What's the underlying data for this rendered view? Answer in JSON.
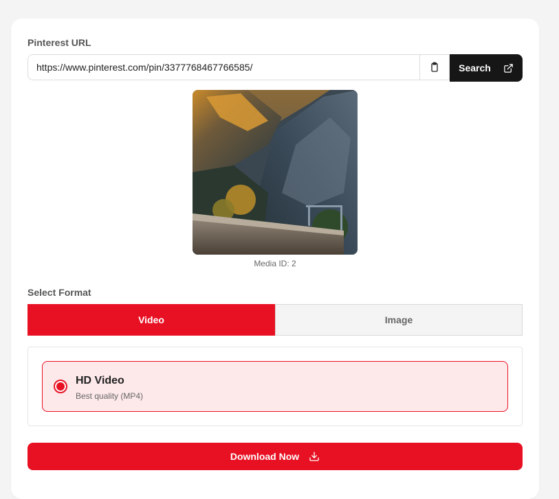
{
  "url_section": {
    "label": "Pinterest URL",
    "value": "https://www.pinterest.com/pin/3377768467766585/",
    "paste_icon": "clipboard-icon",
    "search_label": "Search",
    "search_icon": "external-link-icon"
  },
  "media": {
    "caption": "Media ID: 2"
  },
  "format": {
    "label": "Select Format",
    "tabs": [
      {
        "label": "Video",
        "active": true
      },
      {
        "label": "Image",
        "active": false
      }
    ],
    "options": [
      {
        "title": "HD Video",
        "subtitle": "Best quality (MP4)",
        "selected": true
      }
    ]
  },
  "download": {
    "label": "Download Now",
    "icon": "download-icon"
  },
  "colors": {
    "accent": "#e81123",
    "dark_button": "#161616",
    "selected_bg": "#fde8ea"
  }
}
